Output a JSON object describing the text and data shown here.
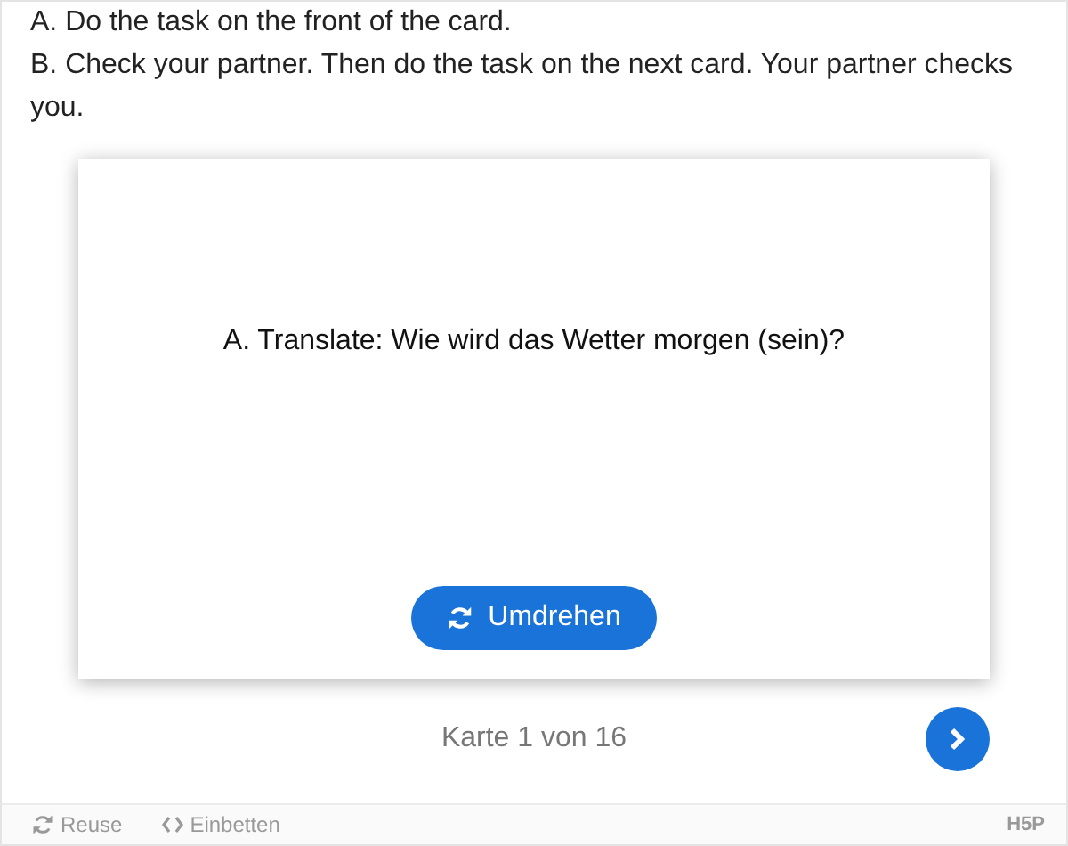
{
  "instructions": [
    "A. Do the task on the front of the card.",
    "B. Check your partner. Then do the task on the next card. Your partner checks you."
  ],
  "card": {
    "text": "A. Translate: Wie wird das Wetter morgen (sein)?",
    "flip_button": "Umdrehen"
  },
  "progress": "Karte 1 von 16",
  "footer": {
    "links": [
      {
        "kind": "reuse",
        "label": "Reuse"
      },
      {
        "kind": "embed",
        "label": "Einbetten"
      }
    ],
    "logo": "H5P"
  }
}
